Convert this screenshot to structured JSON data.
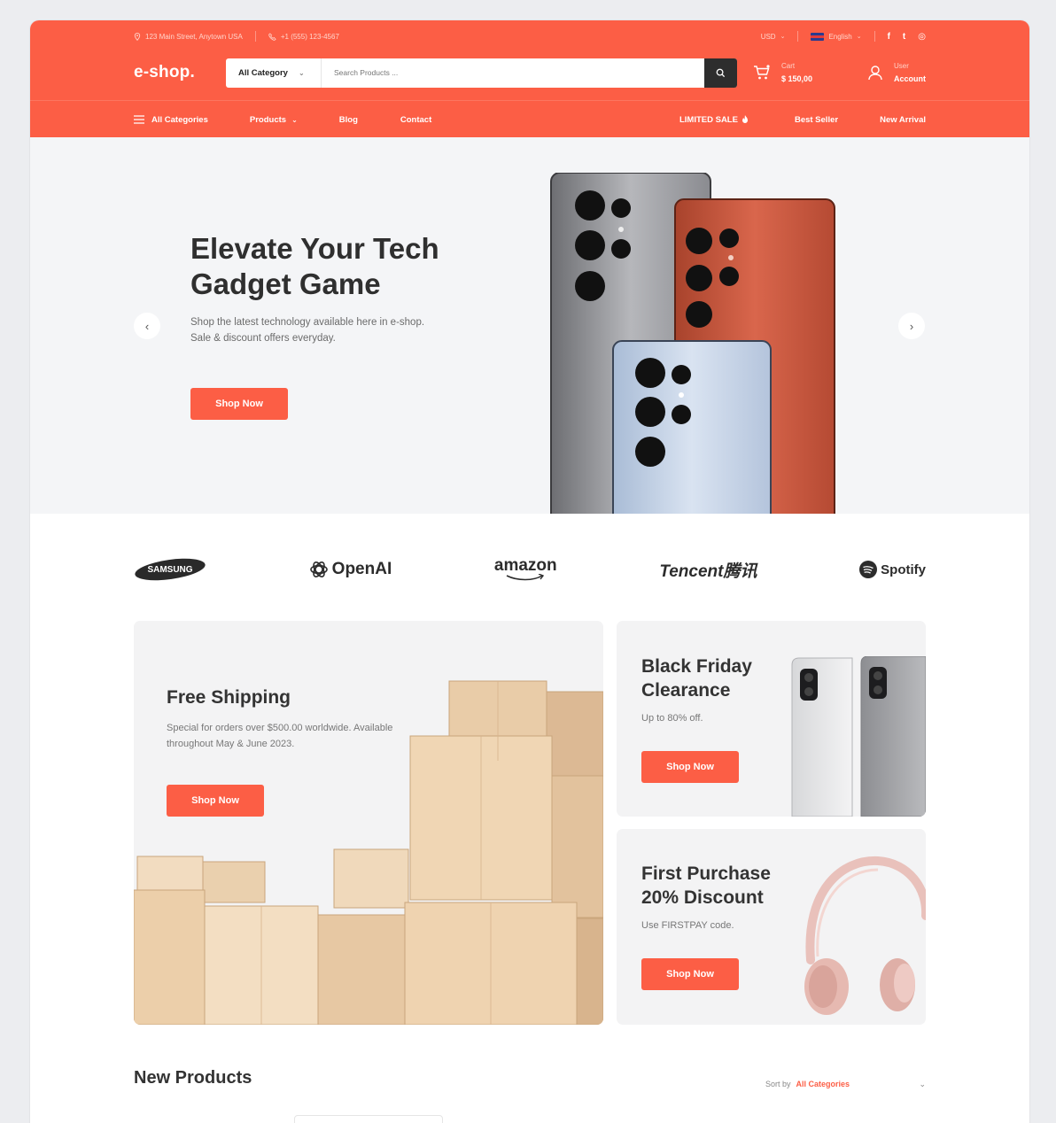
{
  "topbar": {
    "address": "123 Main Street, Anytown USA",
    "phone": "+1 (555) 123-4567",
    "currency": "USD",
    "language": "English",
    "social": [
      "f",
      "t",
      "◎"
    ]
  },
  "header": {
    "logo": "e-shop.",
    "category_select": "All Category",
    "search_placeholder": "Search Products ...",
    "cart_label": "Cart",
    "cart_amount": "$ 150,00",
    "user_label": "User",
    "account_label": "Account"
  },
  "nav": {
    "all_categories": "All Categories",
    "products": "Products",
    "blog": "Blog",
    "contact": "Contact",
    "limited_sale": "LIMITED SALE",
    "best_seller": "Best Seller",
    "new_arrival": "New Arrival"
  },
  "hero": {
    "title": "Elevate Your Tech Gadget Game",
    "subtitle": "Shop the latest technology available here in e-shop. Sale & discount offers everyday.",
    "cta": "Shop Now"
  },
  "brands": [
    "SAMSUNG",
    "OpenAI",
    "amazon",
    "Tencent腾讯",
    "Spotify"
  ],
  "promos": {
    "shipping": {
      "title": "Free Shipping",
      "desc": "Special for orders over $500.00 worldwide. Available throughout May & June 2023.",
      "cta": "Shop Now"
    },
    "black_friday": {
      "title": "Black Friday Clearance",
      "desc": "Up to 80% off.",
      "cta": "Shop Now"
    },
    "first_purchase": {
      "title": "First Purchase 20% Discount",
      "desc": "Use FIRSTPAY code.",
      "cta": "Shop Now"
    }
  },
  "new_products": {
    "title": "New Products",
    "sort_label": "Sort by",
    "sort_value": "All Categories"
  },
  "colors": {
    "accent": "#fc5e45",
    "dark": "#2d2d2d"
  }
}
